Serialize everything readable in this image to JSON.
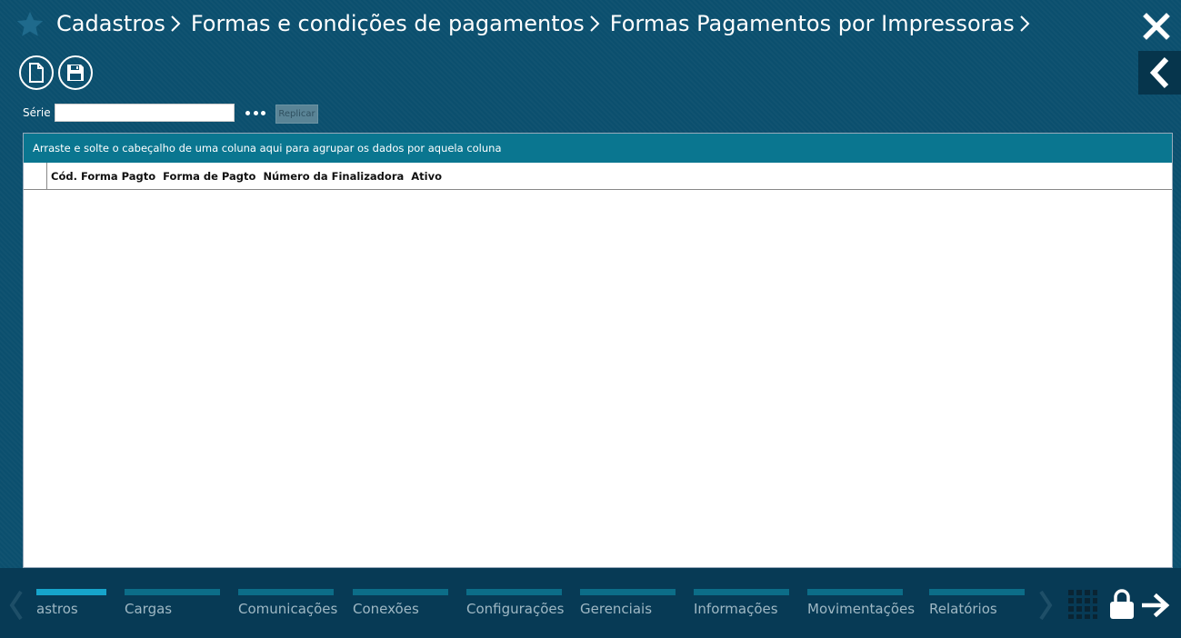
{
  "breadcrumb": [
    "Cadastros",
    "Formas e condições de pagamentos",
    "Formas Pagamentos por Impressoras"
  ],
  "toolbar": {
    "new_icon": "new-document-icon",
    "save_icon": "floppy-disk-icon"
  },
  "filter": {
    "serie_label": "Série",
    "serie_value": "",
    "replicar_label": "Replicar"
  },
  "grid": {
    "group_panel_text": "Arraste e solte o cabeçalho de uma coluna aqui para agrupar os dados por aquela coluna",
    "columns": [
      "Cód. Forma Pagto",
      "Forma de Pagto",
      "Número da Finalizadora",
      "Ativo"
    ],
    "rows": []
  },
  "bottom_menu": {
    "items": [
      {
        "label": "astros",
        "active": true
      },
      {
        "label": "Cargas",
        "active": false
      },
      {
        "label": "Comunicações",
        "active": false
      },
      {
        "label": "Conexões",
        "active": false
      },
      {
        "label": "Configurações",
        "active": false
      },
      {
        "label": "Gerenciais",
        "active": false
      },
      {
        "label": "Informações",
        "active": false
      },
      {
        "label": "Movimentações",
        "active": false
      },
      {
        "label": "Relatórios",
        "active": false
      }
    ]
  },
  "colors": {
    "background": "#0b4f6e",
    "bottom_bar": "#073a55",
    "accent": "#16a4cb",
    "group_panel": "#0a7690"
  }
}
